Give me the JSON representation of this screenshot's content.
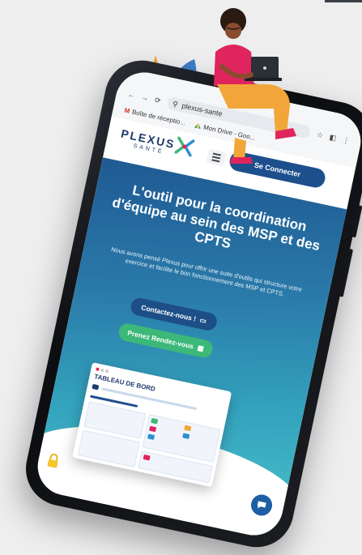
{
  "browser": {
    "url": "plexus-sante",
    "bookmarks": [
      "Boîte de réceptio...",
      "Mon Drive - Goo..."
    ],
    "gmail_glyph": "M"
  },
  "site": {
    "logo_text": "PLEXUS",
    "logo_sub": "SANTÉ",
    "connect_label": "Se Connecter"
  },
  "hero": {
    "headline": "L'outil pour la coordination d'équipe au sein des MSP et des CPTS",
    "subtext": "Nous avons pensé Plexus pour offrir une suite d'outils qui structure votre exercice et facilite le bon fonctionnement des MSP et CPTS.",
    "contact_label": "Contactez-nous !",
    "rdv_label": "Prenez Rendez-vous"
  },
  "dashboard": {
    "title": "TABLEAU DE BORD"
  },
  "colors": {
    "brand_blue": "#1e4f8d",
    "brand_green": "#3cb878",
    "hero_start": "#1f5a93",
    "hero_end": "#4cc4cc",
    "accent_orange": "#f2a63a",
    "accent_pink": "#e0245e"
  },
  "icons": [
    "back-arrow-icon",
    "forward-arrow-icon",
    "reload-icon",
    "site-info-icon",
    "star-icon",
    "extensions-icon",
    "menu-icon",
    "x-logo-icon",
    "chat-icon",
    "calendar-icon",
    "lock-icon"
  ]
}
